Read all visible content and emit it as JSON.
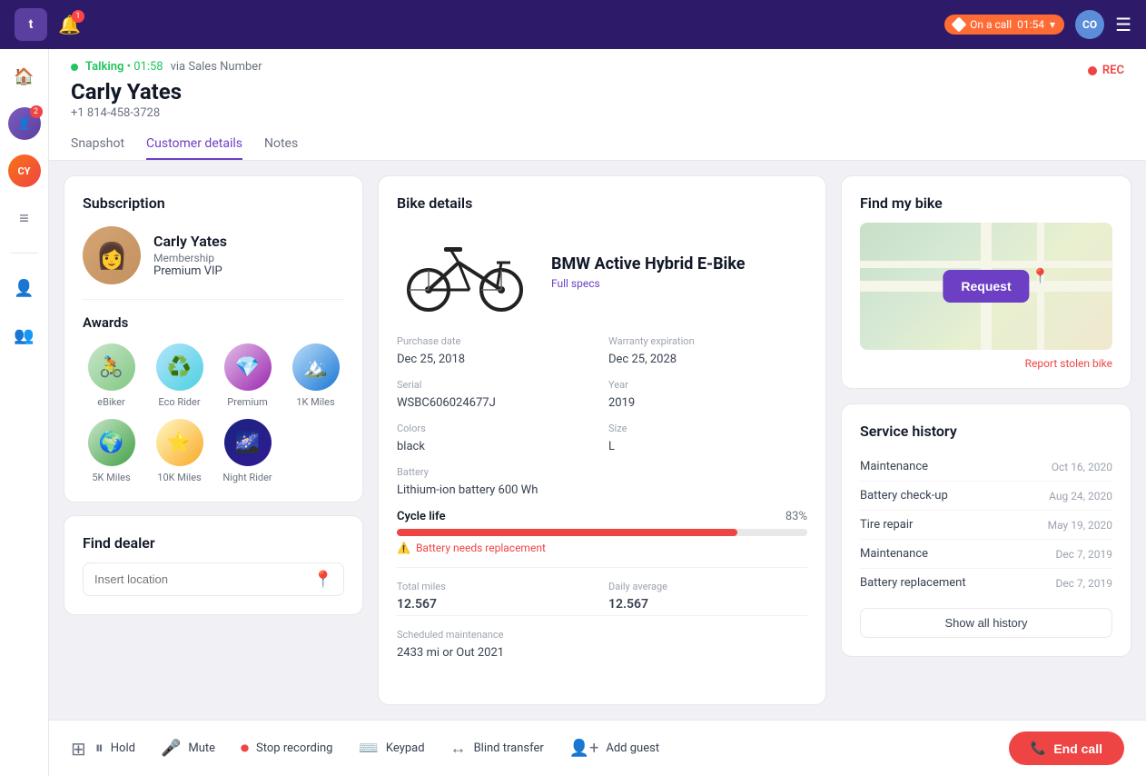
{
  "topbar": {
    "logo": "t",
    "on_call_label": "On a call",
    "timer": "01:54",
    "avatar_initials": "CO",
    "menu_icon": "☰"
  },
  "contact_header": {
    "status": "Talking",
    "timer": "01:58",
    "via": "via Sales Number",
    "name": "Carly Yates",
    "phone": "+1 814-458-3728",
    "rec_label": "REC",
    "tabs": [
      "Snapshot",
      "Customer details",
      "Notes"
    ],
    "active_tab": "Customer details"
  },
  "subscription": {
    "title": "Subscription",
    "subscriber_name": "Carly Yates",
    "membership_label": "Membership",
    "membership_value": "Premium VIP",
    "awards_title": "Awards",
    "awards": [
      {
        "label": "eBiker",
        "emoji": "🚴"
      },
      {
        "label": "Eco Rider",
        "emoji": "♻️"
      },
      {
        "label": "Premium",
        "emoji": "💎"
      },
      {
        "label": "1K Miles",
        "emoji": "🏔️"
      },
      {
        "label": "5K Miles",
        "emoji": "🌍"
      },
      {
        "label": "10K Miles",
        "emoji": "⭐"
      },
      {
        "label": "Night Rider",
        "emoji": "🌌"
      }
    ]
  },
  "find_dealer": {
    "title": "Find dealer",
    "input_placeholder": "Insert location",
    "pin_icon": "📍"
  },
  "bike_details": {
    "title": "Bike details",
    "name": "BMW Active Hybrid E-Bike",
    "full_specs": "Full specs",
    "purchase_date_label": "Purchase date",
    "purchase_date": "Dec 25, 2018",
    "warranty_label": "Warranty expiration",
    "warranty": "Dec 25, 2028",
    "serial_label": "Serial",
    "serial": "WSBC606024677J",
    "year_label": "Year",
    "year": "2019",
    "colors_label": "Colors",
    "colors": "black",
    "size_label": "Size",
    "size": "L",
    "battery_label": "Battery",
    "battery": "Lithium-ion battery 600 Wh",
    "cycle_life_label": "Cycle life",
    "cycle_life_pct": "83%",
    "cycle_life_value": 83,
    "battery_warning": "Battery needs replacement",
    "total_miles_label": "Total miles",
    "total_miles": "12.567",
    "daily_avg_label": "Daily average",
    "daily_avg": "12.567",
    "scheduled_label": "Scheduled maintenance",
    "scheduled": "2433 mi or Out 2021"
  },
  "find_bike": {
    "title": "Find my bike",
    "request_btn": "Request",
    "report_stolen": "Report stolen bike"
  },
  "service_history": {
    "title": "Service history",
    "items": [
      {
        "name": "Maintenance",
        "date": "Oct 16, 2020"
      },
      {
        "name": "Battery check-up",
        "date": "Aug 24, 2020"
      },
      {
        "name": "Tire repair",
        "date": "May 19, 2020"
      },
      {
        "name": "Maintenance",
        "date": "Dec 7, 2019"
      },
      {
        "name": "Battery replacement",
        "date": "Dec 7, 2019"
      }
    ],
    "show_all": "Show all history"
  },
  "bottom_bar": {
    "hold": "Hold",
    "mute": "Mute",
    "stop_recording": "Stop recording",
    "keypad": "Keypad",
    "blind_transfer": "Blind transfer",
    "add_guest": "Add guest",
    "end_call": "End call"
  },
  "sidebar": {
    "icons": [
      "🏠",
      "≡",
      "👤",
      "👥"
    ],
    "avatar_badge": "2",
    "cy_initials": "CY"
  }
}
